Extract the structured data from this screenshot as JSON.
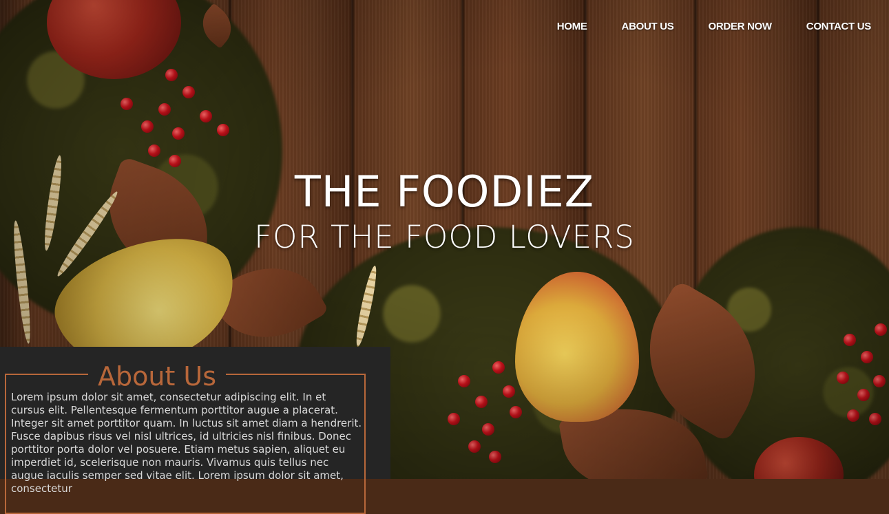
{
  "nav": {
    "items": [
      {
        "label": "HOME"
      },
      {
        "label": "ABOUT US"
      },
      {
        "label": "ORDER NOW"
      },
      {
        "label": "CONTACT US"
      }
    ]
  },
  "hero": {
    "title": "THE FOODIEZ",
    "subtitle": "FOR THE FOOD LOVERS"
  },
  "about": {
    "heading": "About Us",
    "body": "Lorem ipsum dolor sit amet, consectetur adipiscing elit. In et cursus elit. Pellentesque fermentum porttitor augue a placerat. Integer sit amet porttitor quam. In luctus sit amet diam a hendrerit. Fusce dapibus risus vel nisl ultrices, id ultricies nisl finibus. Donec porttitor porta dolor vel posuere. Etiam metus sapien, aliquet eu imperdiet id, scelerisque non mauris. Vivamus quis tellus nec augue iaculis semper sed vitae elit. Lorem ipsum dolor sit amet, consectetur"
  },
  "colors": {
    "accent": "#b8673a",
    "panel_bg": "#252525",
    "nav_text": "#ffffff"
  }
}
